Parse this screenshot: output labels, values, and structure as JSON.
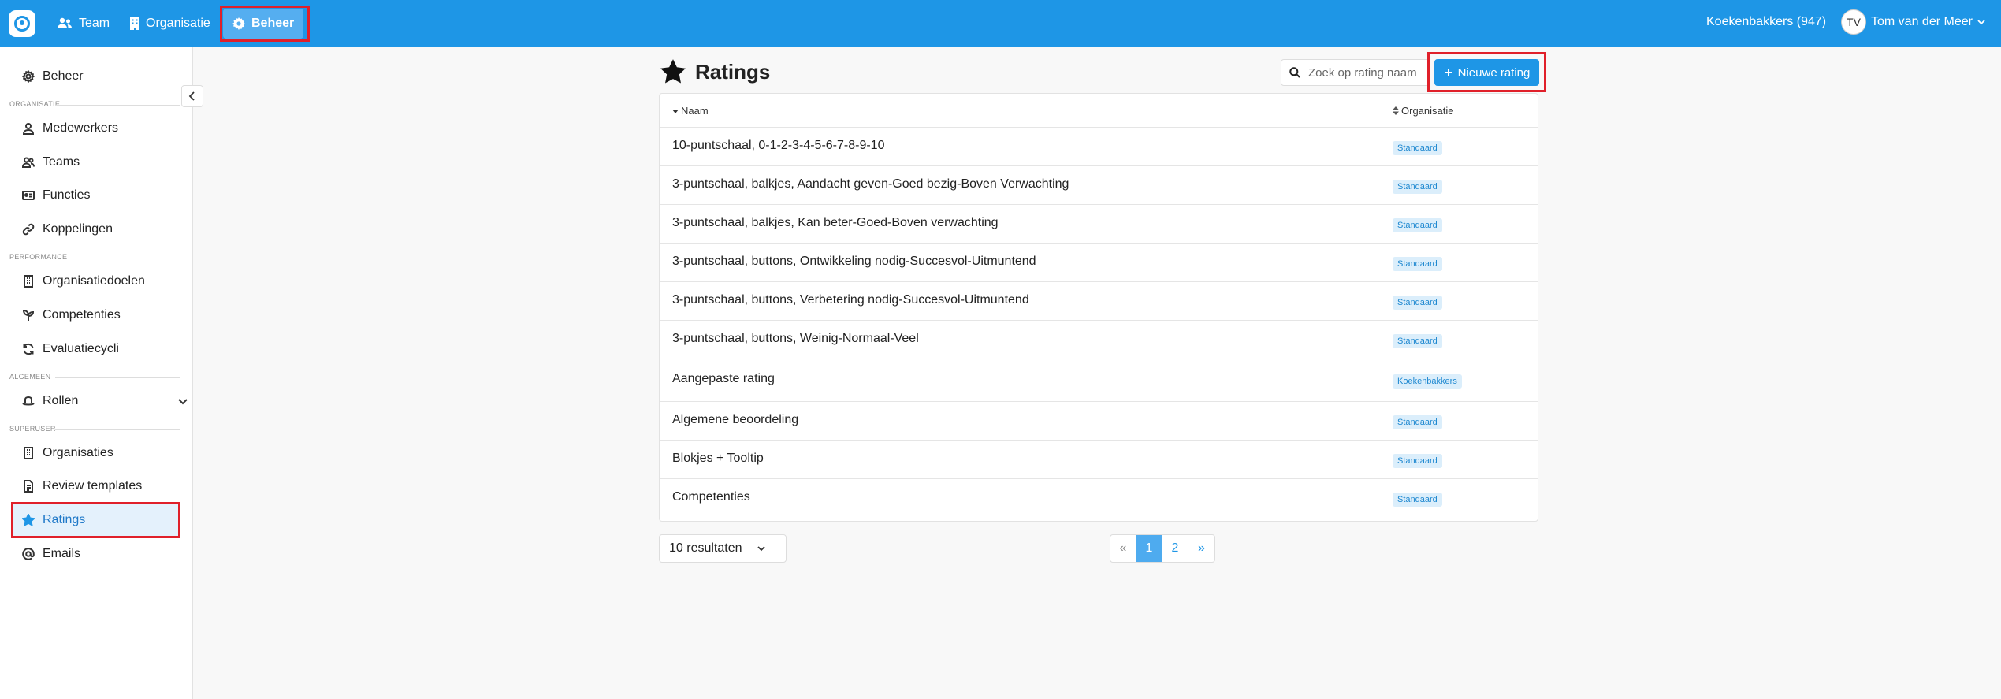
{
  "topbar": {
    "nav": [
      {
        "label": "Team",
        "icon": "users-icon"
      },
      {
        "label": "Organisatie",
        "icon": "building-icon"
      },
      {
        "label": "Beheer",
        "icon": "gear-icon"
      }
    ],
    "org_count": "Koekenbakkers (947)",
    "avatar_initials": "TV",
    "user_name": "Tom van der Meer"
  },
  "sidebar": {
    "beheer": "Beheer",
    "sections": {
      "organisatie": "ORGANISATIE",
      "performance": "PERFORMANCE",
      "algemeen": "ALGEMEEN",
      "superuser": "SUPERUSER"
    },
    "items": {
      "medewerkers": "Medewerkers",
      "teams": "Teams",
      "functies": "Functies",
      "koppelingen": "Koppelingen",
      "organisatiedoelen": "Organisatiedoelen",
      "competenties": "Competenties",
      "evaluatiecycli": "Evaluatiecycli",
      "rollen": "Rollen",
      "organisaties": "Organisaties",
      "review_templates": "Review templates",
      "ratings": "Ratings",
      "emails": "Emails"
    }
  },
  "main": {
    "title": "Ratings",
    "search_placeholder": "Zoek op rating naam",
    "new_button": "Nieuwe rating",
    "columns": {
      "name": "Naam",
      "org": "Organisatie"
    },
    "rows": [
      {
        "name": "10-puntschaal, 0-1-2-3-4-5-6-7-8-9-10",
        "org": "Standaard"
      },
      {
        "name": "3-puntschaal, balkjes, Aandacht geven-Goed bezig-Boven Verwachting",
        "org": "Standaard"
      },
      {
        "name": "3-puntschaal, balkjes, Kan beter-Goed-Boven verwachting",
        "org": "Standaard"
      },
      {
        "name": "3-puntschaal, buttons, Ontwikkeling nodig-Succesvol-Uitmuntend",
        "org": "Standaard"
      },
      {
        "name": "3-puntschaal, buttons, Verbetering nodig-Succesvol-Uitmuntend",
        "org": "Standaard"
      },
      {
        "name": "3-puntschaal, buttons, Weinig-Normaal-Veel",
        "org": "Standaard"
      },
      {
        "name": "Aangepaste rating",
        "org": "Koekenbakkers"
      },
      {
        "name": "Algemene beoordeling",
        "org": "Standaard"
      },
      {
        "name": "Blokjes + Tooltip",
        "org": "Standaard"
      },
      {
        "name": "Competenties",
        "org": "Standaard"
      }
    ],
    "results_select": "10 resultaten",
    "pagination": {
      "prev": "«",
      "pages": [
        "1",
        "2"
      ],
      "next": "»",
      "current": "1"
    }
  },
  "colors": {
    "brand": "#1e96e6",
    "highlight": "#e0202a",
    "badge_bg": "#dbeefb"
  }
}
